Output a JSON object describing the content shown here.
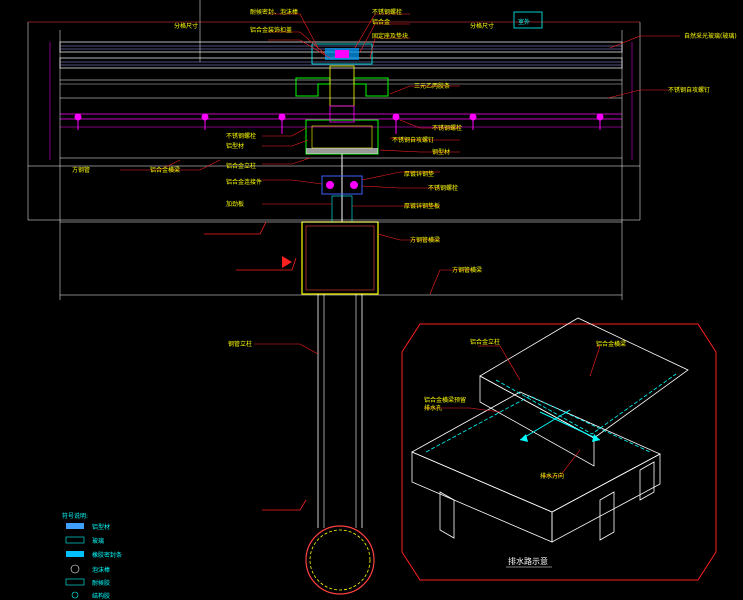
{
  "labels": {
    "room_outside": "室外",
    "top_left_dim": "分格尺寸",
    "top_mid_dim": "分格尺寸",
    "weather_seal": "耐候密封、泡沫棒",
    "stainless_screw_top": "不锈钢螺栓",
    "aluminum_pressure": "铝合金",
    "al_cover": "铝合金装饰扣盖",
    "fixing_strip": "固定座及垫块",
    "glass_right": "自然采光玻璃(玻璃)",
    "tri_rubber": "三元乙丙胶条",
    "stainless_self_tap": "不锈钢自攻螺钉",
    "stainless_bolt_l": "不锈钢螺栓",
    "al_sub_frame": "铝型材",
    "stainless_bolt_r": "不锈钢螺栓",
    "stainless_self_tap_r": "不锈钢自攻螺钉",
    "steel_profile": "钢型材",
    "al_column": "铝合金立柱",
    "al_connector": "铝合金连接件",
    "square_tube": "方钢管",
    "al_bracket": "铝合金横梁",
    "thick_gasket": "厚镀锌钢垫",
    "stainless_bolt_mid": "不锈钢螺栓",
    "thick_steel_plate": "厚镀锌钢垫板",
    "stiff_plate": "加劲板",
    "square_steel_left": "方钢管横梁",
    "square_steel_right": "方钢管横梁",
    "steel_tube": "钢管立柱",
    "drain_title": "排水路示意",
    "iso_top_left": "铝合金立柱",
    "iso_top_right": "铝合金横梁",
    "iso_left_note_1": "铝合金横梁预留",
    "iso_left_note_2": "排水孔",
    "iso_bottom": "排水方向",
    "legend_title": "符号说明:",
    "legend_1": "铝型材",
    "legend_2": "玻璃",
    "legend_3": "橡胶密封条",
    "legend_4": "泡沫棒",
    "legend_5": "耐候胶",
    "legend_6": "结构胶"
  },
  "colors": {
    "background": "#000000",
    "line_white": "#ffffff",
    "line_cyan": "#00ffff",
    "line_yellow": "#ffff00",
    "line_magenta": "#ff00ff",
    "line_red": "#ff0000",
    "line_green": "#00ff00",
    "line_blue": "#4060ff"
  }
}
